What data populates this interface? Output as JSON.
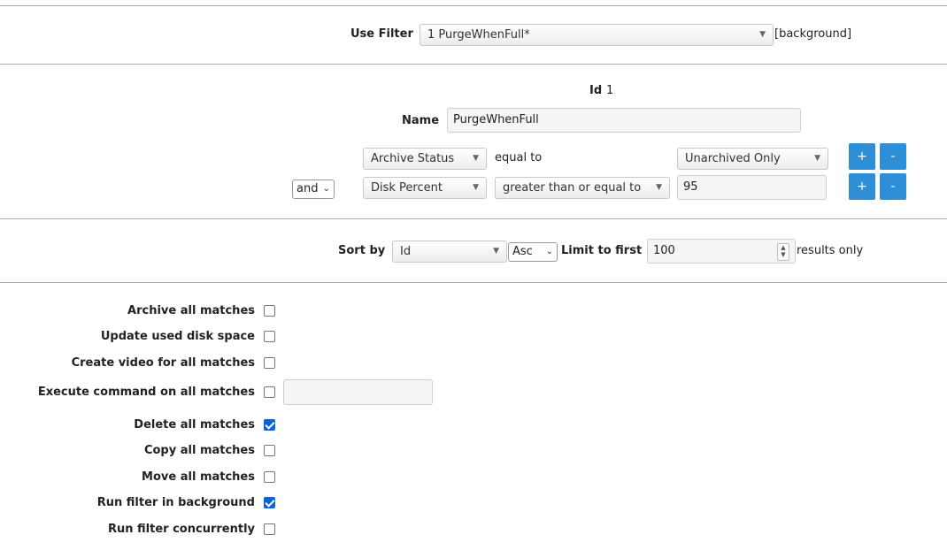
{
  "filter_bar": {
    "use_filter_label": "Use Filter",
    "selected_filter": "1 PurgeWhenFull*",
    "background_tag": "[background]"
  },
  "filter_details": {
    "id_label": "Id",
    "id_value": "1",
    "name_label": "Name",
    "name_value": "PurgeWhenFull",
    "terms": [
      {
        "conjunction": "",
        "attribute": "Archive Status",
        "operator": "equal to",
        "value": "Unarchived Only"
      },
      {
        "conjunction": "and",
        "attribute": "Disk Percent",
        "operator": "greater than or equal to",
        "value": "95"
      }
    ],
    "add_label": "+",
    "remove_label": "-"
  },
  "sort": {
    "sort_by_label": "Sort by",
    "sort_field": "Id",
    "sort_order": "Asc",
    "limit_label": "Limit to first",
    "limit_value": "100",
    "results_only_label": "results only"
  },
  "actions": [
    {
      "label": "Archive all matches",
      "checked": false
    },
    {
      "label": "Update used disk space",
      "checked": false
    },
    {
      "label": "Create video for all matches",
      "checked": false
    },
    {
      "label": "Execute command on all matches",
      "checked": false
    },
    {
      "label": "Delete all matches",
      "checked": true
    },
    {
      "label": "Copy all matches",
      "checked": false
    },
    {
      "label": "Move all matches",
      "checked": false
    },
    {
      "label": "Run filter in background",
      "checked": true
    },
    {
      "label": "Run filter concurrently",
      "checked": false
    }
  ],
  "icons": {
    "dropdown": "caret-down-icon",
    "native_dropdown": "chevron-down-icon",
    "spinner": "number-spinner-icon",
    "checkmark": "checkmark-icon"
  },
  "colors": {
    "button_blue": "#2e8fd6",
    "checkbox_checked": "#0a62d6",
    "divider": "#aaaaaa"
  }
}
